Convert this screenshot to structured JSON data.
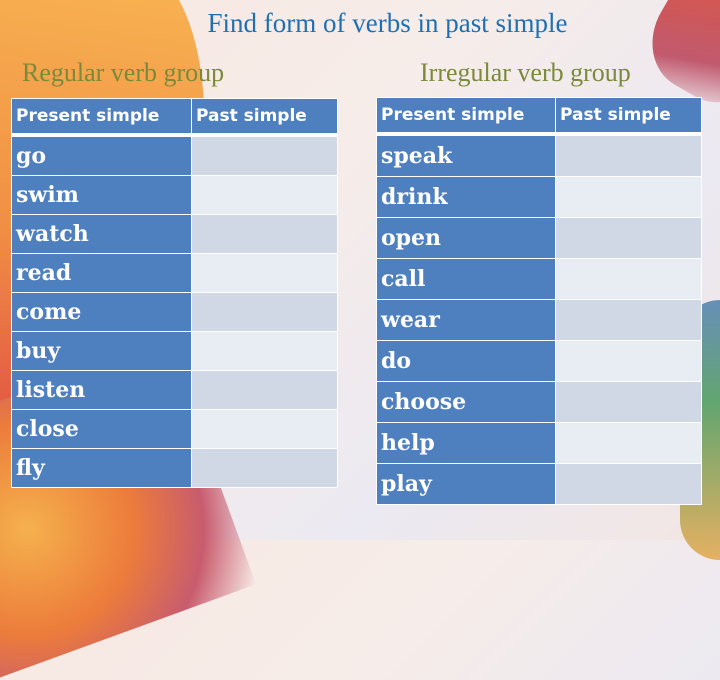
{
  "title": "Find form of verbs in past simple",
  "groups": {
    "regular": {
      "label": "Regular verb group",
      "headers": [
        "Present simple",
        "Past simple"
      ],
      "rows": [
        {
          "present": "go",
          "past": ""
        },
        {
          "present": "swim",
          "past": ""
        },
        {
          "present": "watch",
          "past": ""
        },
        {
          "present": "read",
          "past": ""
        },
        {
          "present": "come",
          "past": ""
        },
        {
          "present": "buy",
          "past": ""
        },
        {
          "present": "listen",
          "past": ""
        },
        {
          "present": "close",
          "past": ""
        },
        {
          "present": "fly",
          "past": ""
        }
      ]
    },
    "irregular": {
      "label": "Irregular verb group",
      "headers": [
        "Present simple",
        "Past simple"
      ],
      "rows": [
        {
          "present": "speak",
          "past": ""
        },
        {
          "present": "drink",
          "past": ""
        },
        {
          "present": "open",
          "past": ""
        },
        {
          "present": "call",
          "past": ""
        },
        {
          "present": "wear",
          "past": ""
        },
        {
          "present": "do",
          "past": ""
        },
        {
          "present": "choose",
          "past": ""
        },
        {
          "present": "help",
          "past": ""
        },
        {
          "present": "play",
          "past": ""
        }
      ]
    }
  },
  "colors": {
    "title": "#1f6fb3",
    "group_label": "#7a8a3a",
    "table_header": "#4e7fbf",
    "cell_dark": "#d0d8e5",
    "cell_light": "#e8ecf3"
  }
}
